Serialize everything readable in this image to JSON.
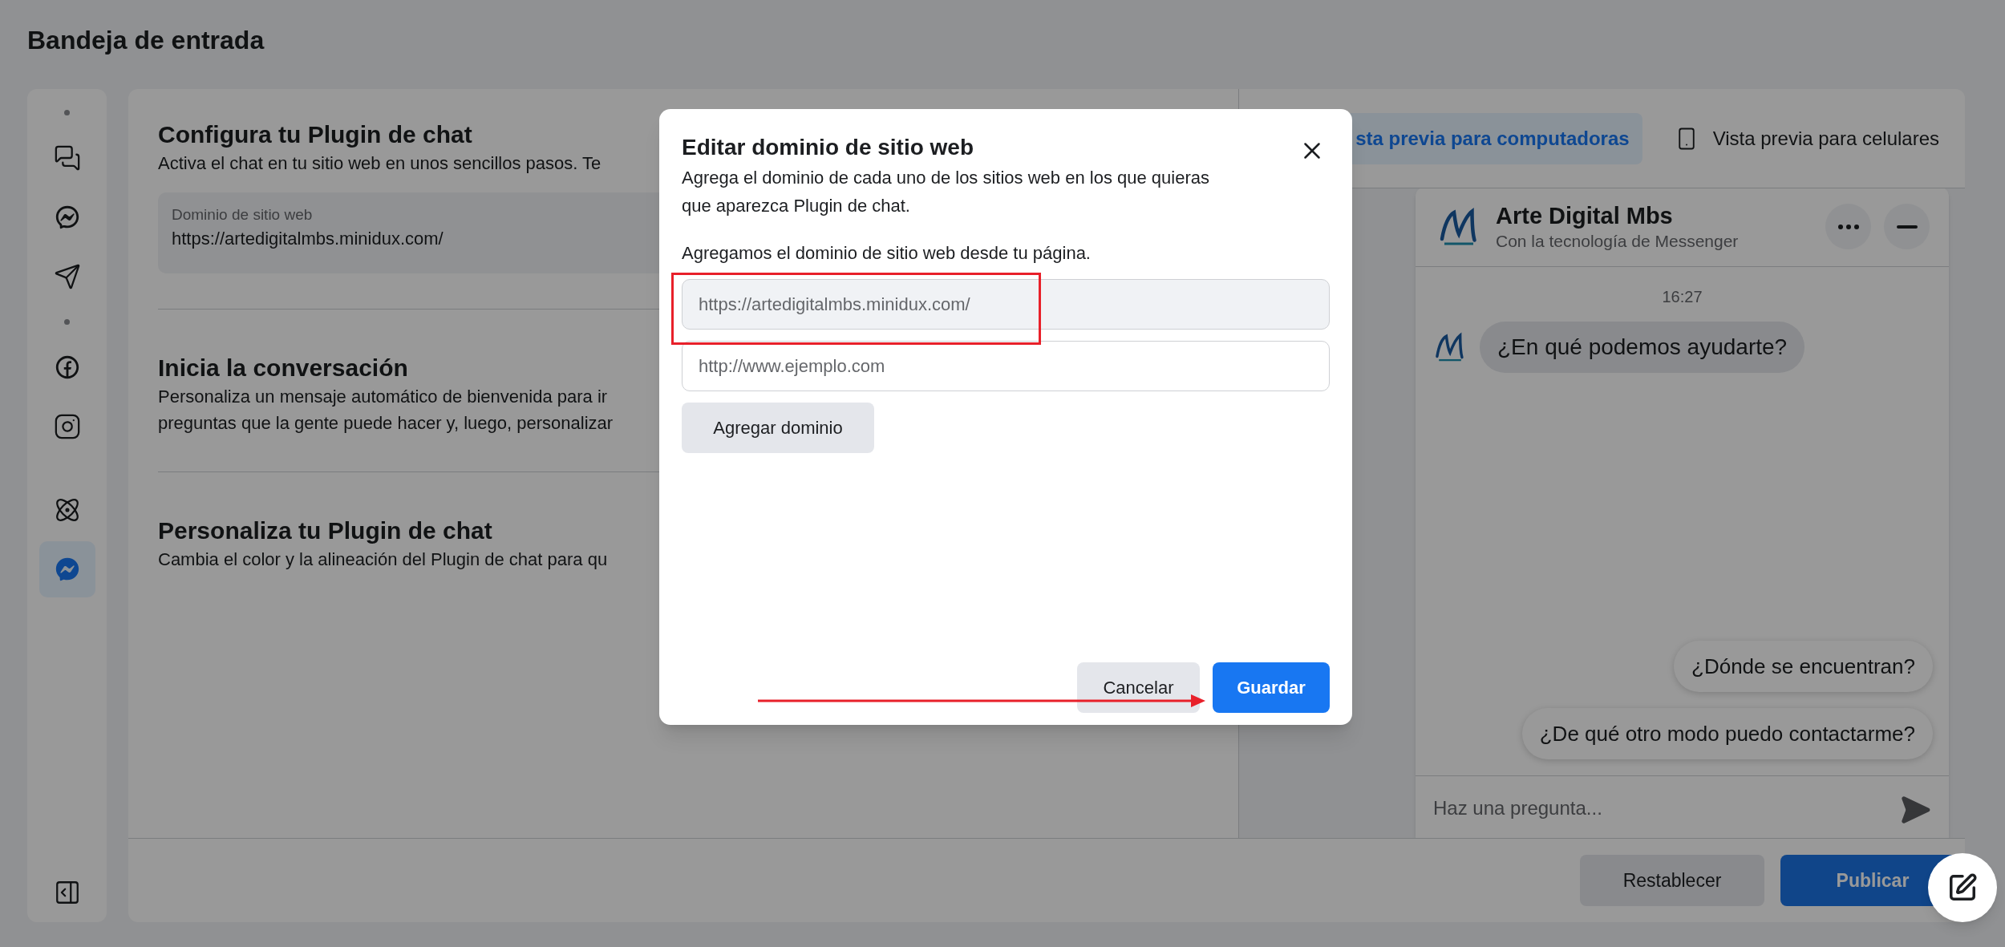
{
  "page_title": "Bandeja de entrada",
  "sidebar": {
    "groups": [
      {
        "dot": true,
        "items": [
          {
            "kind": "chats",
            "selected": false
          },
          {
            "kind": "messenger",
            "selected": false
          },
          {
            "kind": "send",
            "selected": false
          }
        ]
      },
      {
        "dot": true,
        "items": [
          {
            "kind": "facebook",
            "selected": false
          },
          {
            "kind": "instagram",
            "selected": false
          }
        ]
      },
      {
        "dot": false,
        "items": [
          {
            "kind": "atom",
            "selected": false
          },
          {
            "kind": "messenger",
            "selected": true
          }
        ]
      }
    ]
  },
  "sections": [
    {
      "title": "Configura tu Plugin de chat",
      "description": [
        "Activa el chat en tu sitio web en unos sencillos pasos. Te"
      ],
      "field": {
        "label": "Dominio de sitio web",
        "value": "https://artedigitalmbs.minidux.com/"
      }
    },
    {
      "title": "Inicia la conversación",
      "description": [
        "Personaliza un mensaje automático de bienvenida para ir",
        "preguntas que la gente puede hacer y, luego, personalizar"
      ]
    },
    {
      "title": "Personaliza tu Plugin de chat",
      "description": [
        "Cambia el color y la alineación del Plugin de chat para qu"
      ]
    }
  ],
  "preview": {
    "tabs": [
      {
        "label": "sta previa para computadoras",
        "kind": "desktop",
        "selected": true
      },
      {
        "label": "Vista previa para celulares",
        "kind": "mobile",
        "selected": false
      }
    ],
    "chat": {
      "name": "Arte Digital Mbs",
      "subtitle": "Con la tecnología de Messenger",
      "time": "16:27",
      "messages": [
        {
          "text": "¿En qué podemos ayudarte?"
        }
      ],
      "suggestions": [
        "¿Dónde se encuentran?",
        "¿De qué otro modo puedo contactarme?"
      ],
      "input_placeholder": "Haz una pregunta..."
    }
  },
  "footer": {
    "buttons": [
      {
        "label": "Restablecer",
        "kind": "secondary"
      },
      {
        "label": "Publicar",
        "kind": "primary"
      }
    ]
  },
  "modal": {
    "title": "Editar dominio de sitio web",
    "description": "Agrega el dominio de cada uno de los sitios web en los que quieras que aparezca Plugin de chat.",
    "note": "Agregamos el dominio de sitio web desde tu página.",
    "fields": [
      {
        "value": "https://artedigitalmbs.minidux.com/",
        "disabled": true
      },
      {
        "placeholder": "http://www.ejemplo.com",
        "disabled": false
      }
    ],
    "add_button": "Agregar dominio",
    "buttons": [
      {
        "label": "Cancelar",
        "kind": "secondary"
      },
      {
        "label": "Guardar",
        "kind": "primary"
      }
    ]
  }
}
